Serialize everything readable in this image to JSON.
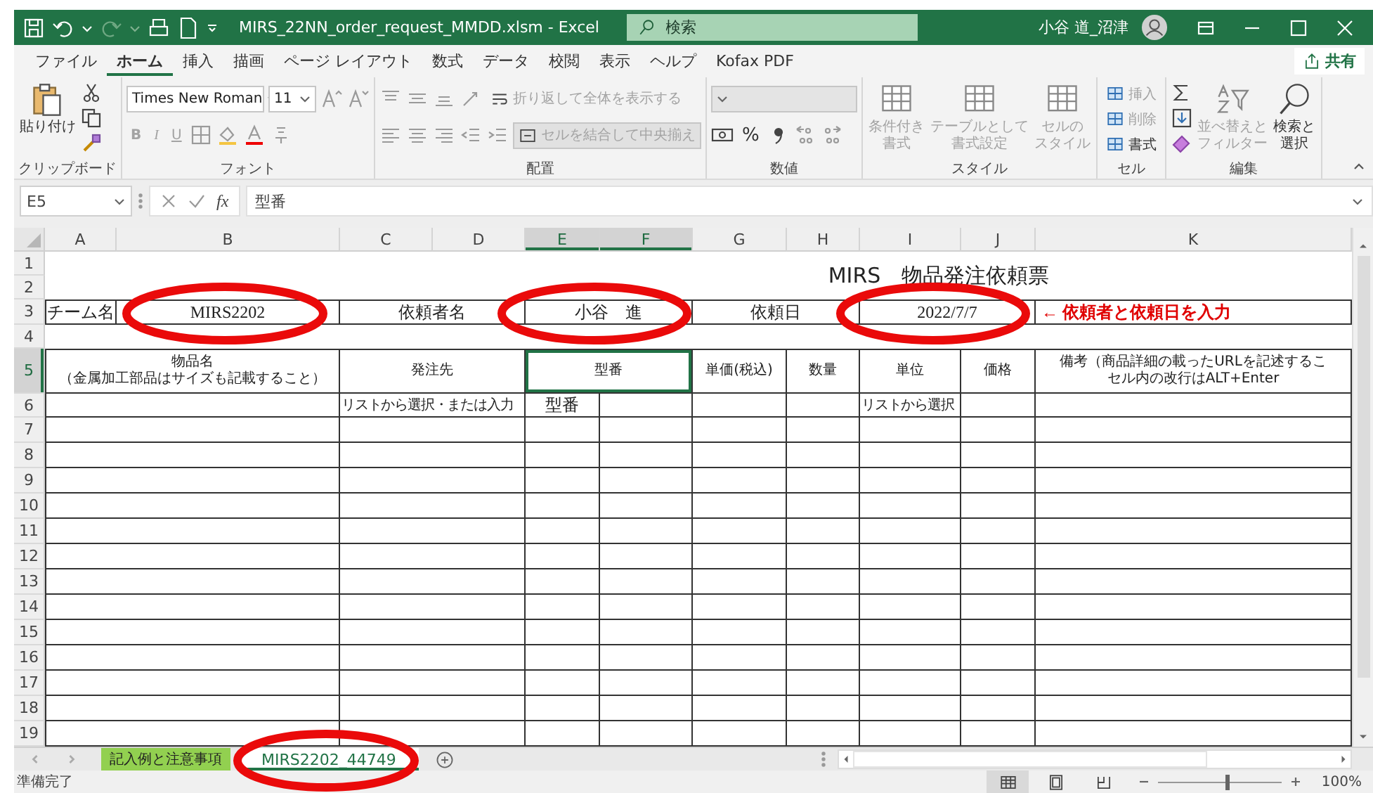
{
  "window": {
    "title": "MIRS_22NN_order_request_MMDD.xlsm  -  Excel",
    "search_placeholder": "検索",
    "user_name": "小谷 道_沼津"
  },
  "menu_tabs": [
    {
      "label": "ファイル",
      "selected": false
    },
    {
      "label": "ホーム",
      "selected": true
    },
    {
      "label": "挿入",
      "selected": false
    },
    {
      "label": "描画",
      "selected": false
    },
    {
      "label": "ページ レイアウト",
      "selected": false
    },
    {
      "label": "数式",
      "selected": false
    },
    {
      "label": "データ",
      "selected": false
    },
    {
      "label": "校閲",
      "selected": false
    },
    {
      "label": "表示",
      "selected": false
    },
    {
      "label": "ヘルプ",
      "selected": false
    },
    {
      "label": "Kofax PDF",
      "selected": false
    }
  ],
  "share_button": "共有",
  "ribbon": {
    "groups": [
      {
        "kind": "clipboard",
        "label": "クリップボード",
        "buttons": [
          {
            "label": "貼り付け",
            "disabled": false
          }
        ]
      },
      {
        "kind": "font",
        "label": "フォント",
        "font_name": "Times New Roman",
        "font_size": "11",
        "buttons": [
          {
            "label": "B",
            "disabled": true
          },
          {
            "label": "I",
            "disabled": true
          },
          {
            "label": "U",
            "disabled": true
          }
        ]
      },
      {
        "kind": "alignment",
        "label": "配置",
        "buttons": [
          {
            "label": "折り返して全体を表示する",
            "disabled": true
          },
          {
            "label": "セルを結合して中央揃え",
            "disabled": true
          }
        ]
      },
      {
        "kind": "number",
        "label": "数値",
        "buttons": [
          {
            "label": "%",
            "disabled": false
          }
        ]
      },
      {
        "kind": "styles",
        "label": "スタイル",
        "buttons": [
          {
            "lines": [
              "条件付き",
              "書式"
            ],
            "disabled": true
          },
          {
            "lines": [
              "テーブルとして",
              "書式設定"
            ],
            "disabled": true
          },
          {
            "lines": [
              "セルの",
              "スタイル"
            ],
            "disabled": true
          }
        ]
      },
      {
        "kind": "cells",
        "label": "セル",
        "buttons": [
          {
            "label": "挿入",
            "disabled": true
          },
          {
            "label": "削除",
            "disabled": true
          },
          {
            "label": "書式",
            "disabled": false
          }
        ]
      },
      {
        "kind": "editing",
        "label": "編集",
        "buttons": [
          {
            "lines": [
              "並べ替えと",
              "フィルター"
            ],
            "disabled": true
          },
          {
            "lines": [
              "検索と",
              "選択"
            ],
            "disabled": false
          }
        ]
      }
    ]
  },
  "formula_bar": {
    "name_box": "E5",
    "function_button": "fx",
    "formula": "型番"
  },
  "sheet": {
    "columns": [
      {
        "label": "A",
        "selected": false
      },
      {
        "label": "B",
        "selected": false
      },
      {
        "label": "C",
        "selected": false
      },
      {
        "label": "D",
        "selected": false
      },
      {
        "label": "E",
        "selected": true
      },
      {
        "label": "F",
        "selected": true
      },
      {
        "label": "G",
        "selected": false
      },
      {
        "label": "H",
        "selected": false
      },
      {
        "label": "I",
        "selected": false
      },
      {
        "label": "J",
        "selected": false
      },
      {
        "label": "K",
        "selected": false
      }
    ],
    "rows": [
      {
        "label": "1",
        "selected": false
      },
      {
        "label": "2",
        "selected": false
      },
      {
        "label": "3",
        "selected": false
      },
      {
        "label": "4",
        "selected": false
      },
      {
        "label": "5",
        "selected": true
      },
      {
        "label": "6",
        "selected": false
      },
      {
        "label": "7",
        "selected": false
      },
      {
        "label": "8",
        "selected": false
      },
      {
        "label": "9",
        "selected": false
      },
      {
        "label": "10",
        "selected": false
      },
      {
        "label": "11",
        "selected": false
      },
      {
        "label": "12",
        "selected": false
      },
      {
        "label": "13",
        "selected": false
      },
      {
        "label": "14",
        "selected": false
      },
      {
        "label": "15",
        "selected": false
      },
      {
        "label": "16",
        "selected": false
      },
      {
        "label": "17",
        "selected": false
      },
      {
        "label": "18",
        "selected": false
      },
      {
        "label": "19",
        "selected": false
      }
    ],
    "cells": [
      {
        "kind": "title",
        "text": "MIRS　物品発注依頼票",
        "selected": false
      },
      {
        "kind": "label",
        "text": "チーム名",
        "selected": false
      },
      {
        "kind": "value",
        "text": "MIRS2202",
        "selected": false
      },
      {
        "kind": "label",
        "text": "依頼者名",
        "selected": false
      },
      {
        "kind": "value",
        "text": "小谷　進",
        "selected": false
      },
      {
        "kind": "label",
        "text": "依頼日",
        "selected": false
      },
      {
        "kind": "value",
        "text": "2022/7/7",
        "selected": false
      },
      {
        "kind": "note",
        "text": "← 依頼者と依頼日を入力",
        "selected": false
      },
      {
        "kind": "header",
        "lines": [
          "物品名",
          "（金属加工部品はサイズも記載すること）"
        ],
        "selected": false
      },
      {
        "kind": "header",
        "text": "発注先",
        "selected": false
      },
      {
        "kind": "header",
        "text": "型番",
        "selected": true
      },
      {
        "kind": "header",
        "text": "単価(税込)",
        "selected": false
      },
      {
        "kind": "header",
        "text": "数量",
        "selected": false
      },
      {
        "kind": "header",
        "text": "単位",
        "selected": false
      },
      {
        "kind": "header",
        "text": "価格",
        "selected": false
      },
      {
        "kind": "header",
        "lines": [
          "備考（商品詳細の載ったURLを記述するこ",
          "セル内の改行はALT+Enter"
        ],
        "selected": false
      },
      {
        "kind": "hint",
        "text": "リストから選択・または入力",
        "selected": false
      },
      {
        "kind": "label",
        "text": "型番",
        "selected": false
      },
      {
        "kind": "hint",
        "text": "リストから選択",
        "selected": false
      }
    ]
  },
  "sheet_tabs": [
    {
      "label": "記入例と注意事項",
      "selected": false,
      "color": "#92d050"
    },
    {
      "label": "MIRS2202_44749",
      "selected": true
    }
  ],
  "status_bar": {
    "status": "準備完了",
    "view_buttons": [
      {
        "selected": true
      },
      {
        "selected": false
      },
      {
        "selected": false
      }
    ],
    "zoom": {
      "level": 0.55,
      "label": "100%"
    }
  }
}
